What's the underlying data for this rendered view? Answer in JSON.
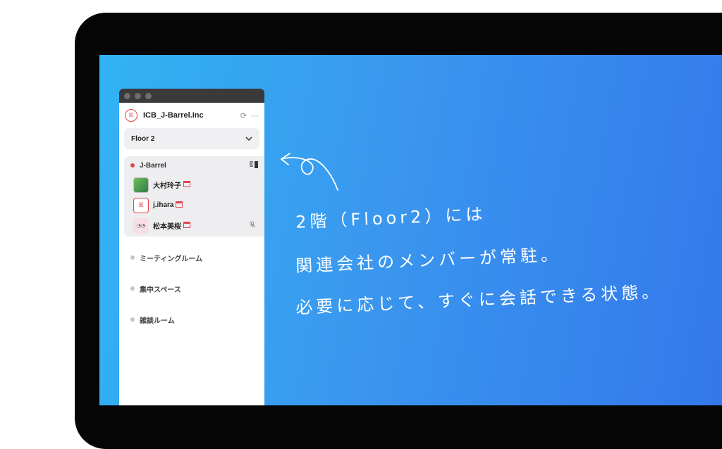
{
  "workspace": {
    "name": "ICB_J-Barrel.inc",
    "logo_text": "ꕤ"
  },
  "floor_selector": {
    "label": "Floor 2"
  },
  "rooms": [
    {
      "name": "J-Barrel",
      "status_color": "#e2454b",
      "members": [
        {
          "name": "大村玲子"
        },
        {
          "name": "j.ihara"
        },
        {
          "name": "松本美桜"
        }
      ]
    },
    {
      "name": "ミーティングルーム"
    },
    {
      "name": "集中スペース"
    },
    {
      "name": "雑談ルーム"
    }
  ],
  "annotation": {
    "line1": "2階（Floor2）には",
    "line2": "関連会社のメンバーが常駐。",
    "line3": "必要に応じて、すぐに会話できる状態。"
  },
  "colors": {
    "accent": "#e2454b",
    "bg_gradient_start": "#31b3f3",
    "bg_gradient_end": "#3478ea"
  },
  "icons": [
    "refresh-icon",
    "more-icon",
    "chevron-down-icon",
    "door-icon",
    "calendar-icon",
    "mute-icon",
    "arrow-icon"
  ]
}
